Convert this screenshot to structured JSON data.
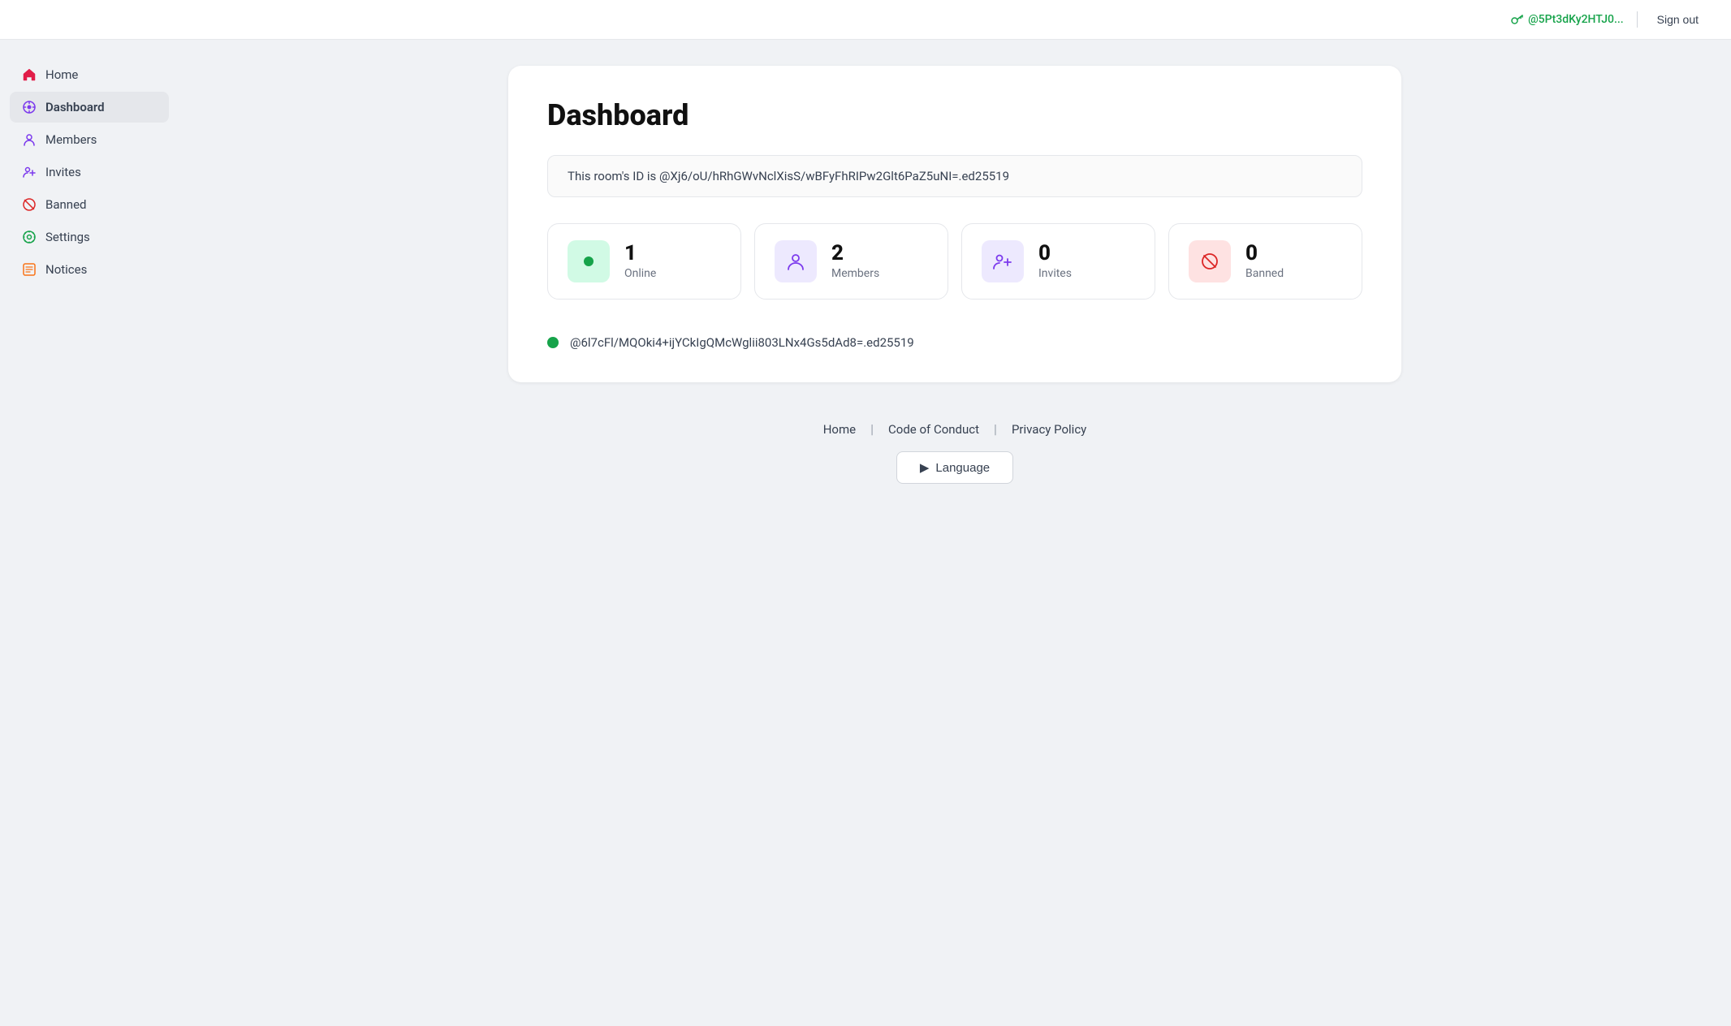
{
  "topbar": {
    "user_id": "@5Pt3dKy2HTJ0...",
    "signout_label": "Sign out"
  },
  "sidebar": {
    "items": [
      {
        "id": "home",
        "label": "Home",
        "icon": "home",
        "active": false
      },
      {
        "id": "dashboard",
        "label": "Dashboard",
        "icon": "dashboard",
        "active": true
      },
      {
        "id": "members",
        "label": "Members",
        "icon": "members",
        "active": false
      },
      {
        "id": "invites",
        "label": "Invites",
        "icon": "invites",
        "active": false
      },
      {
        "id": "banned",
        "label": "Banned",
        "icon": "banned",
        "active": false
      },
      {
        "id": "settings",
        "label": "Settings",
        "icon": "settings",
        "active": false
      },
      {
        "id": "notices",
        "label": "Notices",
        "icon": "notices",
        "active": false
      }
    ]
  },
  "main": {
    "title": "Dashboard",
    "room_id_text": "This room's ID is @Xj6/oU/hRhGWvNclXisS/wBFyFhRIPw2Glt6PaZ5uNI=.ed25519",
    "stats": [
      {
        "id": "online",
        "number": "1",
        "label": "Online",
        "icon": "online",
        "color": "green"
      },
      {
        "id": "members",
        "number": "2",
        "label": "Members",
        "icon": "members",
        "color": "purple"
      },
      {
        "id": "invites",
        "number": "0",
        "label": "Invites",
        "icon": "invites",
        "color": "purple"
      },
      {
        "id": "banned",
        "number": "0",
        "label": "Banned",
        "icon": "banned",
        "color": "red"
      }
    ],
    "online_user": "@6l7cFl/MQOki4+ijYCkIgQMcWglii803LNx4Gs5dAd8=.ed25519"
  },
  "footer": {
    "links": [
      {
        "id": "home",
        "label": "Home"
      },
      {
        "id": "code-of-conduct",
        "label": "Code of Conduct"
      },
      {
        "id": "privacy-policy",
        "label": "Privacy Policy"
      }
    ],
    "language_label": "Language",
    "language_arrow": "▶"
  }
}
